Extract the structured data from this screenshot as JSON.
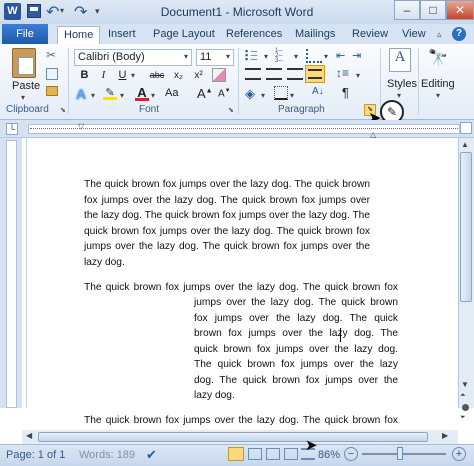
{
  "window": {
    "title": "Document1 - Microsoft Word",
    "minimize": "–",
    "maximize": "□",
    "close": "✕"
  },
  "qat": {
    "app_icon": "W",
    "save": "💾",
    "undo": "↶",
    "redo": "↷",
    "customize": "▾"
  },
  "tabs": [
    {
      "label": "File"
    },
    {
      "label": "Home"
    },
    {
      "label": "Insert"
    },
    {
      "label": "Page Layout"
    },
    {
      "label": "References"
    },
    {
      "label": "Mailings"
    },
    {
      "label": "Review"
    },
    {
      "label": "View"
    }
  ],
  "ribbon": {
    "clipboard": {
      "group_label": "Clipboard",
      "paste_label": "Paste"
    },
    "font": {
      "group_label": "Font",
      "font_name": "Calibri (Body)",
      "font_size": "11",
      "bold": "B",
      "italic": "I",
      "underline": "U",
      "strike": "abc",
      "subscript": "x₂",
      "superscript": "x²",
      "grow": "A",
      "shrink": "A",
      "color_a": "A",
      "case": "Aa"
    },
    "paragraph": {
      "group_label": "Paragraph",
      "pilcrow": "¶",
      "sort": "A↓"
    },
    "styles": {
      "label": "Styles"
    },
    "editing": {
      "label": "Editing"
    }
  },
  "document": {
    "para1": "The quick brown fox jumps over the lazy dog. The quick brown fox jumps over the lazy dog. The quick brown fox jumps over the lazy dog. The quick brown fox jumps over the lazy dog. The quick brown fox jumps over the lazy dog. The quick brown fox jumps over the lazy dog. The quick brown fox jumps over the lazy dog.",
    "para2_first": "The quick brown fox jumps over the lazy dog. The quick brown fox",
    "para2_rest": "jumps over the lazy dog. The quick brown fox jumps over the lazy dog. The quick brown fox jumps over the lazy dog. The quick brown fox jumps over the lazy dog. The quick brown fox jumps over the lazy dog. The quick brown fox jumps over the lazy dog.",
    "para3": "The quick brown fox jumps over the lazy dog. The quick brown fox"
  },
  "status": {
    "page": "Page: 1 of 1",
    "words": "Words: 189",
    "zoom": "86%",
    "zoom_minus": "−",
    "zoom_plus": "+"
  },
  "colors": {
    "accent": "#2b579a",
    "file_tab": "#1d5aa8",
    "highlight": "#ffe000",
    "font_color": "#e02020"
  }
}
